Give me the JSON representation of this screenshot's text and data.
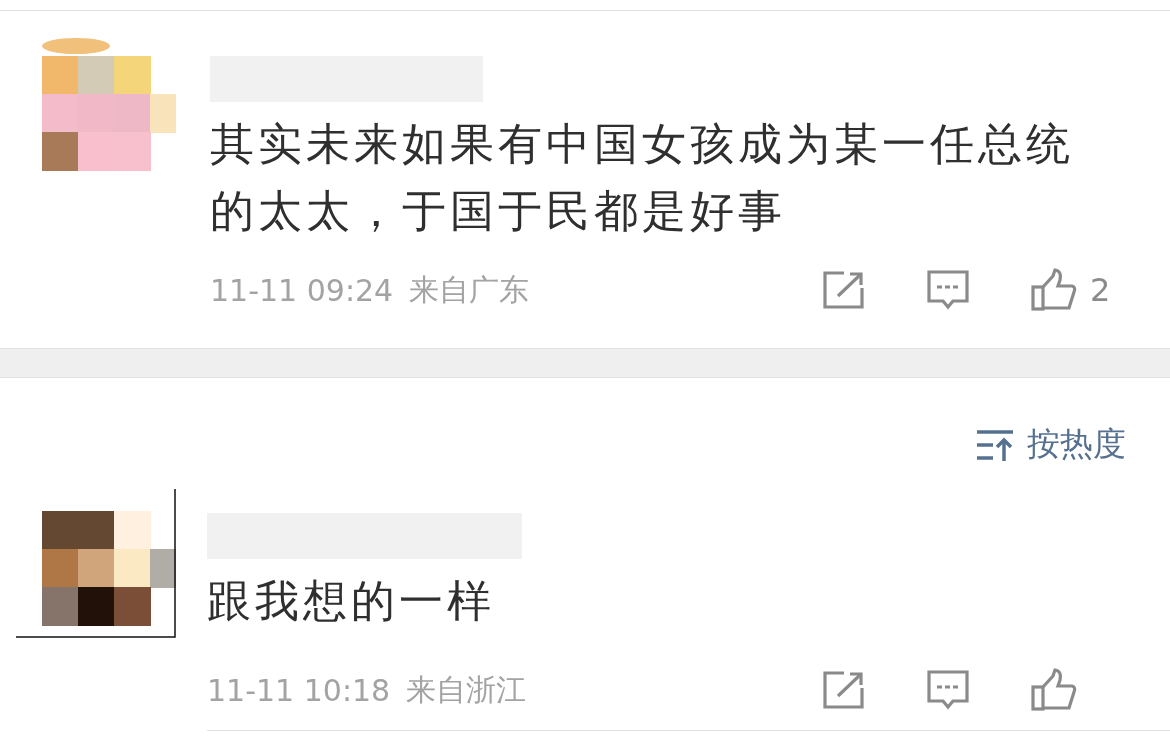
{
  "comments": [
    {
      "text": "其实未来如果有中国女孩成为某一任总统的太太，于国于民都是好事",
      "time": "11-11 09:24",
      "location": "来自广东",
      "likes": "2"
    },
    {
      "text": "跟我想的一样",
      "time": "11-11 10:18",
      "location": "来自浙江"
    }
  ],
  "sort": {
    "label": "按热度"
  }
}
